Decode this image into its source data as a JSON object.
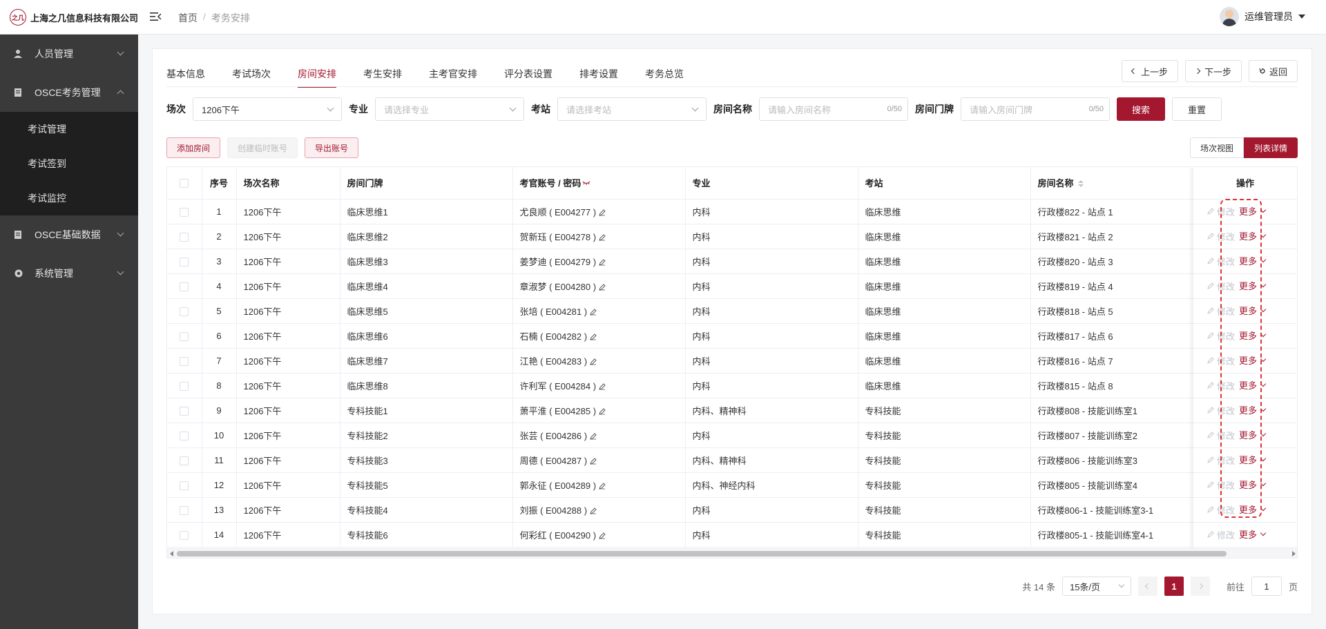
{
  "header": {
    "company": "上海之几信息科技有限公司",
    "logo_mark": "之几",
    "breadcrumb": [
      "首页",
      "考务安排"
    ],
    "breadcrumb_sep": "/",
    "user_name": "运维管理员"
  },
  "sidebar": {
    "items": [
      {
        "label": "人员管理"
      },
      {
        "label": "OSCE考务管理"
      },
      {
        "label": "OSCE基础数据"
      },
      {
        "label": "系统管理"
      }
    ],
    "submenu": [
      "考试管理",
      "考试签到",
      "考试监控"
    ]
  },
  "tabs": [
    "基本信息",
    "考试场次",
    "房间安排",
    "考生安排",
    "主考官安排",
    "评分表设置",
    "排考设置",
    "考务总览"
  ],
  "active_tab": "房间安排",
  "steps": {
    "prev": "上一步",
    "next": "下一步",
    "back": "返回"
  },
  "filters": {
    "session_label": "场次",
    "session_value": "1206下午",
    "major_label": "专业",
    "major_placeholder": "请选择专业",
    "station_label": "考站",
    "station_placeholder": "请选择考站",
    "room_name_label": "房间名称",
    "room_name_placeholder": "请输入房间名称",
    "room_name_count": "0/50",
    "room_door_label": "房间门牌",
    "room_door_placeholder": "请输入房间门牌",
    "room_door_count": "0/50",
    "search": "搜索",
    "reset": "重置"
  },
  "actions": {
    "add_room": "添加房间",
    "create_temp": "创建临时账号",
    "export": "导出账号"
  },
  "views": {
    "session_view": "场次视图",
    "list_detail": "列表详情"
  },
  "table": {
    "headers": [
      "序号",
      "场次名称",
      "房间门牌",
      "考官账号 / 密码",
      "专业",
      "考站",
      "房间名称",
      "操作"
    ],
    "edit_label": "修改",
    "more_label": "更多",
    "rows": [
      {
        "no": "1",
        "session": "1206下午",
        "door": "临床思维1",
        "account": "尤良顺 ( E004277 )",
        "major": "内科",
        "station": "临床思维",
        "room": "行政楼822 - 站点 1"
      },
      {
        "no": "2",
        "session": "1206下午",
        "door": "临床思维2",
        "account": "贺新珏 ( E004278 )",
        "major": "内科",
        "station": "临床思维",
        "room": "行政楼821 - 站点 2"
      },
      {
        "no": "3",
        "session": "1206下午",
        "door": "临床思维3",
        "account": "姜梦迪 ( E004279 )",
        "major": "内科",
        "station": "临床思维",
        "room": "行政楼820 - 站点 3"
      },
      {
        "no": "4",
        "session": "1206下午",
        "door": "临床思维4",
        "account": "章淑梦 ( E004280 )",
        "major": "内科",
        "station": "临床思维",
        "room": "行政楼819 - 站点 4"
      },
      {
        "no": "5",
        "session": "1206下午",
        "door": "临床思维5",
        "account": "张培 ( E004281 )",
        "major": "内科",
        "station": "临床思维",
        "room": "行政楼818 - 站点 5"
      },
      {
        "no": "6",
        "session": "1206下午",
        "door": "临床思维6",
        "account": "石楠 ( E004282 )",
        "major": "内科",
        "station": "临床思维",
        "room": "行政楼817 - 站点 6"
      },
      {
        "no": "7",
        "session": "1206下午",
        "door": "临床思维7",
        "account": "江艳 ( E004283 )",
        "major": "内科",
        "station": "临床思维",
        "room": "行政楼816 - 站点 7"
      },
      {
        "no": "8",
        "session": "1206下午",
        "door": "临床思维8",
        "account": "许利军 ( E004284 )",
        "major": "内科",
        "station": "临床思维",
        "room": "行政楼815 - 站点 8"
      },
      {
        "no": "9",
        "session": "1206下午",
        "door": "专科技能1",
        "account": "萧平淮 ( E004285 )",
        "major": "内科、精神科",
        "station": "专科技能",
        "room": "行政楼808 - 技能训练室1"
      },
      {
        "no": "10",
        "session": "1206下午",
        "door": "专科技能2",
        "account": "张芸 ( E004286 )",
        "major": "内科",
        "station": "专科技能",
        "room": "行政楼807 - 技能训练室2"
      },
      {
        "no": "11",
        "session": "1206下午",
        "door": "专科技能3",
        "account": "周德 ( E004287 )",
        "major": "内科、精神科",
        "station": "专科技能",
        "room": "行政楼806 - 技能训练室3"
      },
      {
        "no": "12",
        "session": "1206下午",
        "door": "专科技能5",
        "account": "郭永征 ( E004289 )",
        "major": "内科、神经内科",
        "station": "专科技能",
        "room": "行政楼805 - 技能训练室4"
      },
      {
        "no": "13",
        "session": "1206下午",
        "door": "专科技能4",
        "account": "刘振 ( E004288 )",
        "major": "内科",
        "station": "专科技能",
        "room": "行政楼806-1 - 技能训练室3-1"
      },
      {
        "no": "14",
        "session": "1206下午",
        "door": "专科技能6",
        "account": "何彩红 ( E004290 )",
        "major": "内科",
        "station": "专科技能",
        "room": "行政楼805-1 - 技能训练室4-1"
      }
    ]
  },
  "pager": {
    "total": "共 14 条",
    "page_size": "15条/页",
    "current": "1",
    "goto_label": "前往",
    "goto_value": "1",
    "page_suffix": "页"
  },
  "colors": {
    "accent": "#a3172f",
    "sidebar_bg": "#3a3a3a",
    "submenu_bg": "#1f1f1f"
  }
}
